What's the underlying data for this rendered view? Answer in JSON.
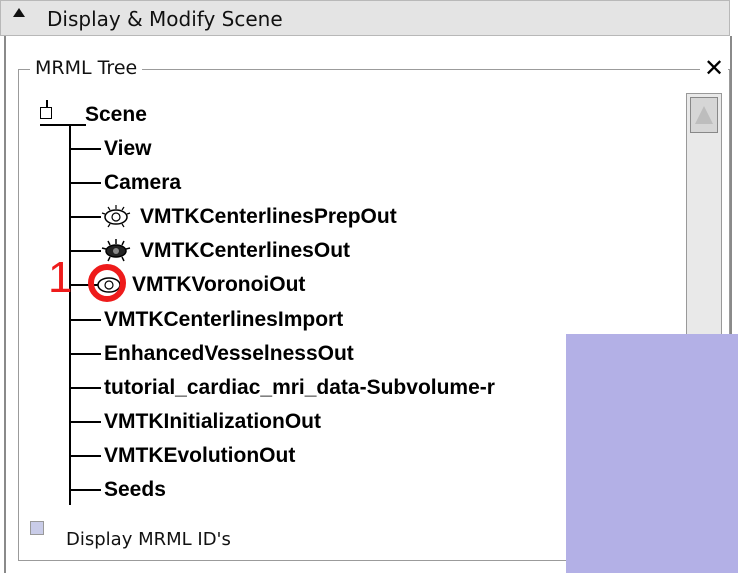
{
  "header": {
    "title": "Display & Modify Scene"
  },
  "group": {
    "title": "MRML Tree",
    "close": "✕"
  },
  "tree": {
    "root": "Scene",
    "items": [
      {
        "label": "View"
      },
      {
        "label": "Camera"
      },
      {
        "label": "VMTKCenterlinesPrepOut",
        "icon": "eye-open-icon"
      },
      {
        "label": "VMTKCenterlinesOut",
        "icon": "eye-closed-icon"
      },
      {
        "label": "VMTKVoronoiOut",
        "icon": "eye-open-icon"
      },
      {
        "label": "VMTKCenterlinesImport"
      },
      {
        "label": "EnhancedVesselnessOut"
      },
      {
        "label": "tutorial_cardiac_mri_data-Subvolume-r"
      },
      {
        "label": "VMTKInitializationOut"
      },
      {
        "label": "VMTKEvolutionOut"
      },
      {
        "label": "Seeds"
      }
    ]
  },
  "footer": {
    "checkbox_label": "Display MRML ID's",
    "checked": false
  },
  "callout": {
    "number": "1",
    "color": "#ee1b1b"
  },
  "colors": {
    "overlay": "#b3b0e6"
  }
}
